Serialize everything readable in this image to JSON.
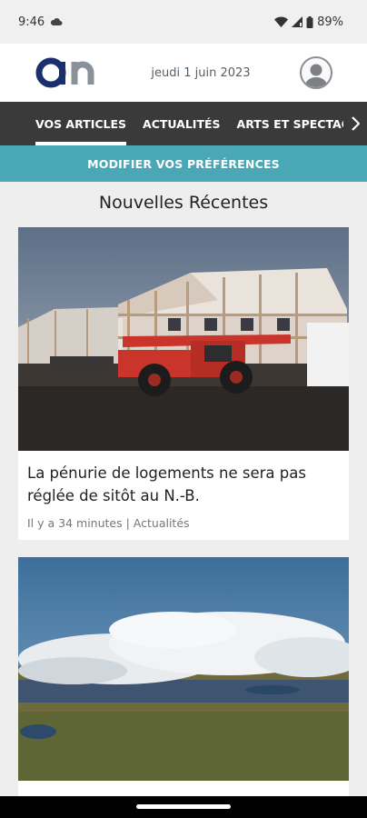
{
  "status_bar": {
    "time": "9:46",
    "battery": "89%",
    "icons": [
      "cloud-icon",
      "wifi-icon",
      "signal-icon",
      "battery-icon"
    ]
  },
  "header": {
    "logo_text": "an",
    "date": "jeudi 1 juin 2023",
    "logo_color": "#1b2f6e",
    "logo_accent": "#8a9199"
  },
  "nav": {
    "tabs": [
      {
        "label": "VOS ARTICLES",
        "active": true
      },
      {
        "label": "ACTUALITÉS",
        "active": false
      },
      {
        "label": "ARTS ET SPECTACLES",
        "active": false
      }
    ],
    "background": "#3a3a3a"
  },
  "preferences_button": {
    "label": "MODIFIER VOS PRÉFÉRENCES",
    "color": "#4aa7b6"
  },
  "section": {
    "title": "Nouvelles Récentes"
  },
  "articles": [
    {
      "headline": "La pénurie de logements ne sera pas réglée de sitôt au N.-B.",
      "time": "Il y a 34 minutes",
      "category": "Actualités",
      "image": "construction-site-photo"
    },
    {
      "headline": "",
      "time": "",
      "category": "",
      "image": "wildfire-smoke-aerial-photo"
    }
  ]
}
